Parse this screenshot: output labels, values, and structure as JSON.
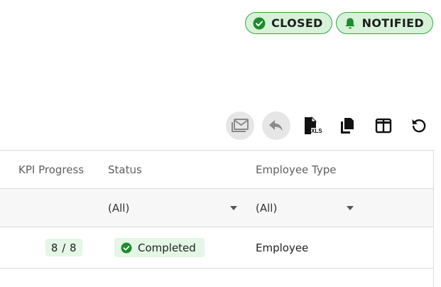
{
  "badges": [
    {
      "label": "CLOSED",
      "icon": "check-circle-icon"
    },
    {
      "label": "NOTIFIED",
      "icon": "bell-icon"
    }
  ],
  "colors": {
    "badge_bg": "#d6f2d8",
    "badge_border": "#3aa346",
    "success": "#1f8a2e",
    "pill_bg": "#e4f6e5"
  },
  "toolbar": {
    "buttons": [
      {
        "name": "email-button",
        "icon": "email-icon",
        "disabled": true
      },
      {
        "name": "reply-button",
        "icon": "reply-icon",
        "disabled": true
      },
      {
        "name": "export-xls-button",
        "icon": "xls-file-icon",
        "disabled": false
      },
      {
        "name": "copy-button",
        "icon": "copy-icon",
        "disabled": false
      },
      {
        "name": "columns-button",
        "icon": "columns-icon",
        "disabled": false
      },
      {
        "name": "refresh-button",
        "icon": "refresh-icon",
        "disabled": false
      }
    ],
    "xls_text": "XLS"
  },
  "grid": {
    "columns": [
      "KPI Progress",
      "Status",
      "Employee Type"
    ],
    "filters": {
      "status": "(All)",
      "employee_type": "(All)"
    },
    "rows": [
      {
        "kpi_progress": "8 / 8",
        "status": "Completed",
        "employee_type": "Employee"
      }
    ]
  }
}
